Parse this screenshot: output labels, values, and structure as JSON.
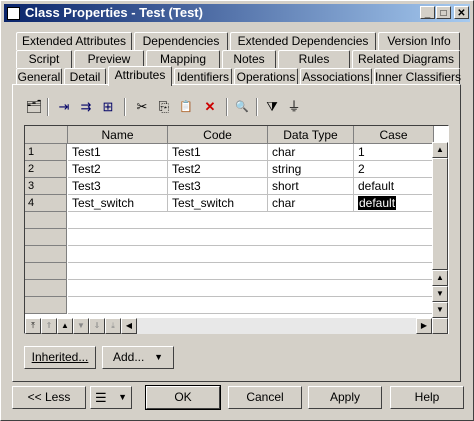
{
  "window": {
    "title": "Class Properties - Test (Test)",
    "controls": {
      "minimize": "_",
      "maximize": "□",
      "close": "✕"
    }
  },
  "tabs": {
    "row1": [
      "Extended Attributes",
      "Dependencies",
      "Extended Dependencies",
      "Version Info"
    ],
    "row2": [
      "Script",
      "Preview",
      "Mapping",
      "Notes",
      "Rules",
      "Related Diagrams"
    ],
    "row3": [
      "General",
      "Detail",
      "Attributes",
      "Identifiers",
      "Operations",
      "Associations",
      "Inner Classifiers"
    ],
    "active": "Attributes"
  },
  "toolbar": {
    "icons": [
      "properties-icon",
      "insert-row-icon",
      "add-row-icon",
      "add-columns-icon",
      "cut-icon",
      "copy-icon",
      "paste-icon",
      "delete-icon",
      "find-icon",
      "filter-icon",
      "clear-filter-icon"
    ],
    "glyphs": [
      "🗂",
      "⇥",
      "⇉",
      "⊞",
      "✂",
      "⎘",
      "📋",
      "✕",
      "🔍",
      "⧩",
      "⏚"
    ]
  },
  "grid": {
    "columns": [
      "Name",
      "Code",
      "Data Type",
      "Case"
    ],
    "rows": [
      {
        "num": "1",
        "name": "Test1",
        "code": "Test1",
        "type": "char",
        "case": "1"
      },
      {
        "num": "2",
        "name": "Test2",
        "code": "Test2",
        "type": "string",
        "case": "2"
      },
      {
        "num": "3",
        "name": "Test3",
        "code": "Test3",
        "type": "short",
        "case": "default"
      },
      {
        "num": "4",
        "name": "Test_switch",
        "code": "Test_switch",
        "type": "char",
        "case": "default"
      }
    ],
    "selected_cell_text": "default"
  },
  "buttons": {
    "inherited": "Inherited...",
    "add": "Add...",
    "less": "<< Less",
    "ok": "OK",
    "cancel": "Cancel",
    "apply": "Apply",
    "help": "Help"
  }
}
